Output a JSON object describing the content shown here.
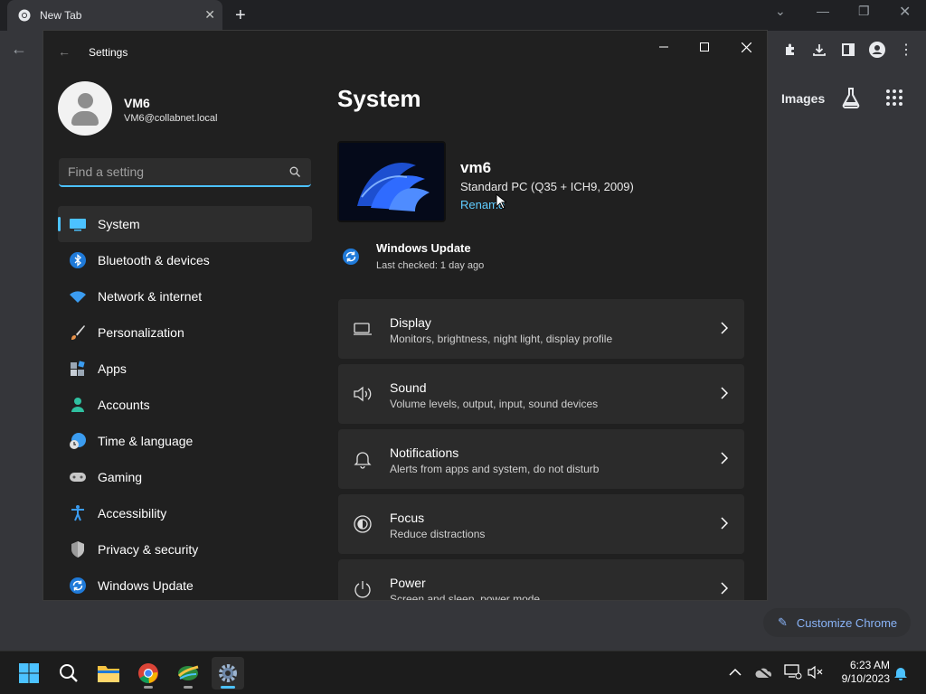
{
  "chrome": {
    "tab_title": "New Tab",
    "images_label": "Images",
    "customize_label": "Customize Chrome"
  },
  "settings": {
    "app_title": "Settings",
    "user": {
      "name": "VM6",
      "email": "VM6@collabnet.local"
    },
    "search_placeholder": "Find a setting",
    "nav": [
      {
        "label": "System",
        "icon": "monitor-icon",
        "active": true
      },
      {
        "label": "Bluetooth & devices",
        "icon": "bluetooth-icon"
      },
      {
        "label": "Network & internet",
        "icon": "wifi-icon"
      },
      {
        "label": "Personalization",
        "icon": "paintbrush-icon"
      },
      {
        "label": "Apps",
        "icon": "apps-icon"
      },
      {
        "label": "Accounts",
        "icon": "accounts-icon"
      },
      {
        "label": "Time & language",
        "icon": "globe-clock-icon"
      },
      {
        "label": "Gaming",
        "icon": "gamepad-icon"
      },
      {
        "label": "Accessibility",
        "icon": "accessibility-icon"
      },
      {
        "label": "Privacy & security",
        "icon": "shield-icon"
      },
      {
        "label": "Windows Update",
        "icon": "update-icon"
      }
    ],
    "main": {
      "title": "System",
      "device_name": "vm6",
      "device_model": "Standard PC (Q35 + ICH9, 2009)",
      "rename_label": "Rename",
      "windows_update": {
        "title": "Windows Update",
        "subtitle": "Last checked: 1 day ago"
      },
      "cards": [
        {
          "title": "Display",
          "subtitle": "Monitors, brightness, night light, display profile",
          "icon": "display-icon"
        },
        {
          "title": "Sound",
          "subtitle": "Volume levels, output, input, sound devices",
          "icon": "speaker-icon"
        },
        {
          "title": "Notifications",
          "subtitle": "Alerts from apps and system, do not disturb",
          "icon": "bell-icon"
        },
        {
          "title": "Focus",
          "subtitle": "Reduce distractions",
          "icon": "focus-icon"
        },
        {
          "title": "Power",
          "subtitle": "Screen and sleep, power mode",
          "icon": "power-icon"
        }
      ]
    }
  },
  "taskbar": {
    "time": "6:23 AM",
    "date": "9/10/2023"
  },
  "colors": {
    "accent": "#4cc2ff",
    "link": "#60cdff",
    "window_bg": "#202020",
    "card_bg": "#2b2b2b"
  }
}
